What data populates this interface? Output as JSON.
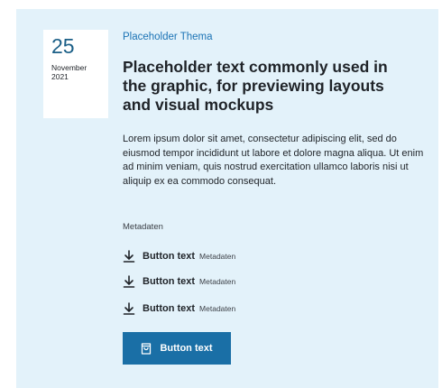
{
  "date": {
    "day": "25",
    "month": "November",
    "year": "2021"
  },
  "article": {
    "topic": "Placeholder Thema",
    "headline": "Placeholder text commonly used in the graphic, for previewing layouts and visual mockups",
    "body": "Lorem ipsum dolor sit amet, consectetur adipiscing elit, sed do eiusmod tempor incididunt ut labore et dolore magna aliqua. Ut enim ad minim veniam, quis nostrud exercitation ullamco laboris nisi ut aliquip ex ea commodo consequat.",
    "meta": "Metadaten"
  },
  "downloads": [
    {
      "label": "Button text",
      "meta": "Metadaten",
      "icon": "download-icon"
    },
    {
      "label": "Button text",
      "meta": "Metadaten",
      "icon": "download-icon"
    },
    {
      "label": "Button text",
      "meta": "Metadaten",
      "icon": "download-icon"
    }
  ],
  "primary_button": {
    "label": "Button text",
    "icon": "shopping-bag-icon"
  },
  "colors": {
    "card_background": "#e3f2fa",
    "accent": "#1a6fa6",
    "topic_link": "#1b73b5",
    "date_day": "#1b5f87"
  }
}
